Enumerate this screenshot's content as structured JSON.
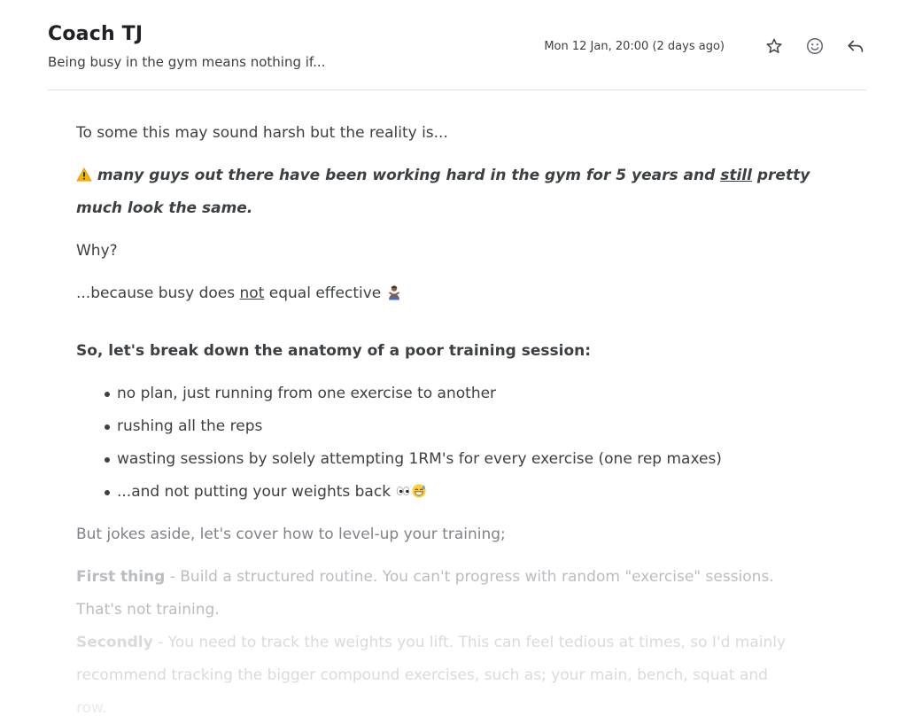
{
  "header": {
    "sender": "Coach TJ",
    "subject": "Being busy in the gym means nothing if...",
    "date": "Mon 12 Jan, 20:00 (2 days ago)"
  },
  "icons": {
    "star": "star-icon",
    "emoji": "smiley-icon",
    "reply": "reply-arrow-icon",
    "warning": "warning-emoji",
    "gesture": "person-crossing-arms-emoji",
    "eyes": "eyes-emoji",
    "sweat": "grinning-sweat-emoji"
  },
  "body": {
    "intro": "To some this may sound harsh but the reality is...",
    "warning_part1": "many guys out there have been working hard in the gym for 5 years and ",
    "warning_still": "still",
    "warning_part2": " pretty much look the same.",
    "why": "Why?",
    "because_part1": "...because busy does ",
    "because_not": "not",
    "because_part2": " equal effective",
    "section_heading": "So, let's break down the anatomy of a poor training session:",
    "bullets": [
      "no plan, just running from one exercise to another",
      "rushing all the reps",
      "wasting sessions by solely attempting 1RM's for every exercise (one rep maxes)",
      "...and not putting your weights back"
    ],
    "jokes_aside": "But jokes aside, let's cover how to level-up your training;",
    "first_label": "First thing",
    "first_text": " - Build a structured routine. You can't progress with random \"exercise\" sessions.",
    "first_text2": "That's not training.",
    "second_label": "Secondly",
    "second_text": " - You need to track the weights you lift. This can feel tedious at times, so I'd mainly",
    "second_text2": "recommend tracking the bigger compound exercises, such as; your main, bench, squat and",
    "second_text3": "row."
  }
}
